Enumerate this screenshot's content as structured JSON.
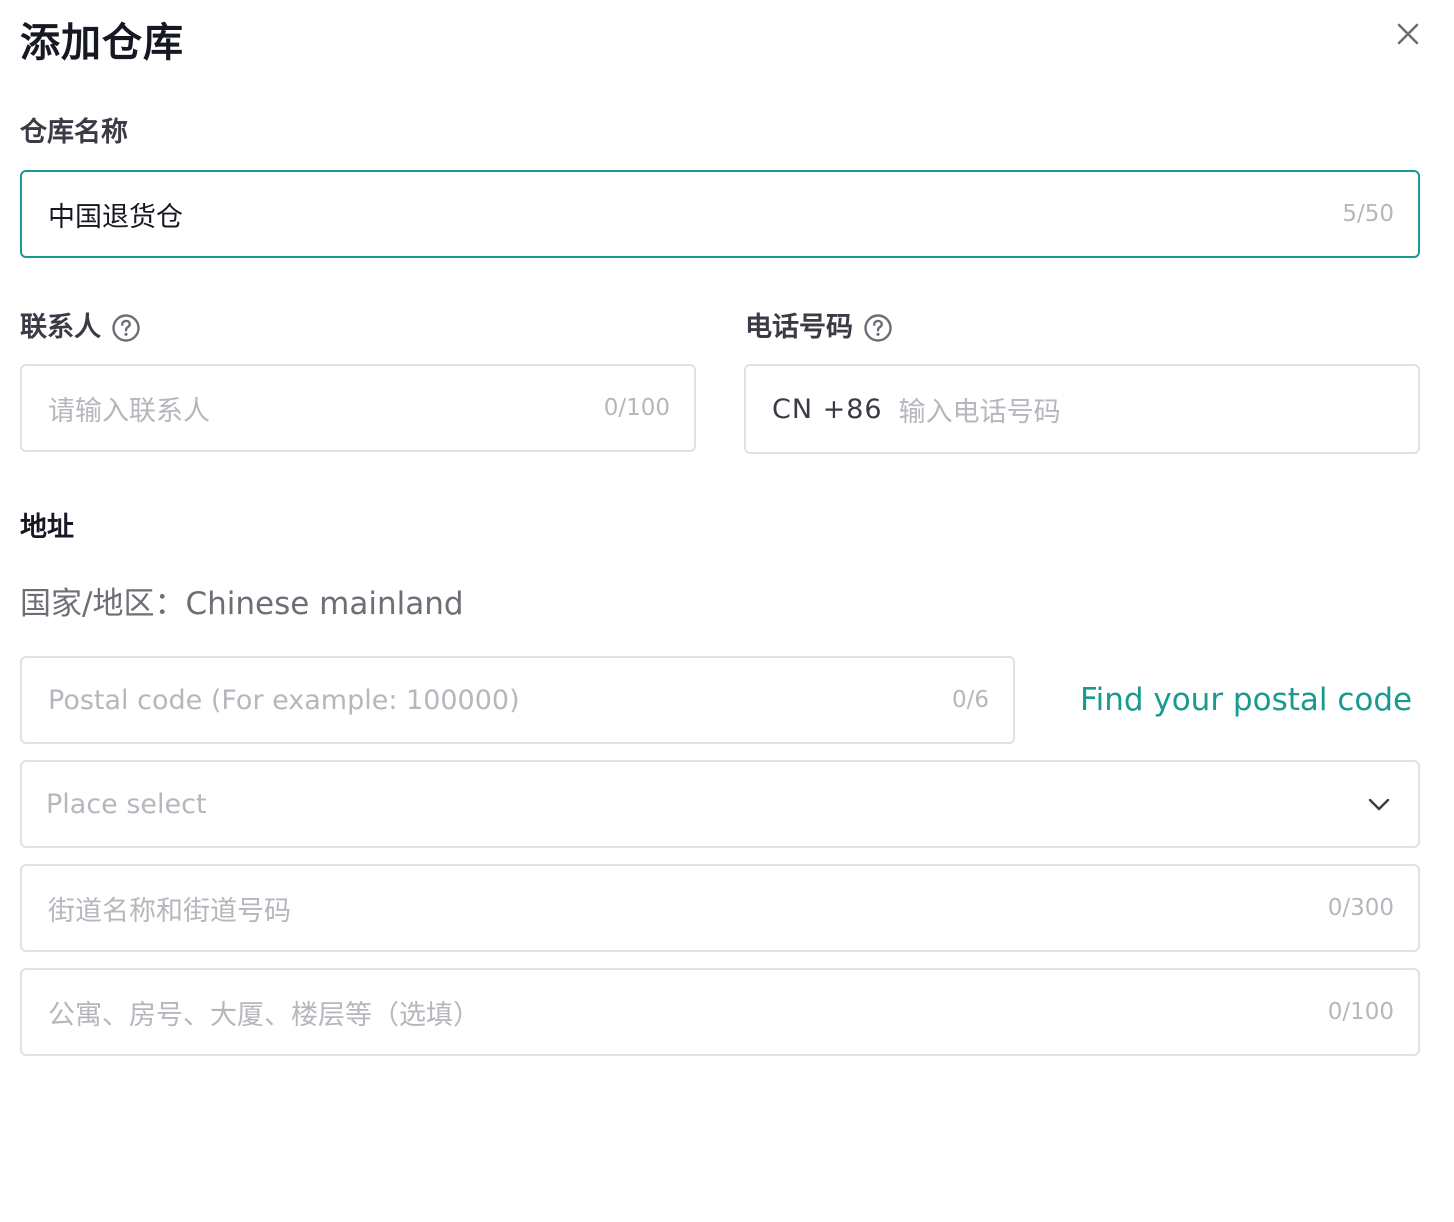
{
  "dialog": {
    "title": "添加仓库"
  },
  "warehouse_name": {
    "label": "仓库名称",
    "value": "中国退货仓",
    "counter": "5/50"
  },
  "contact": {
    "label": "联系人",
    "placeholder": "请输入联系人",
    "counter": "0/100"
  },
  "phone": {
    "label": "电话号码",
    "prefix": "CN +86",
    "placeholder": "输入电话号码"
  },
  "address": {
    "section_title": "地址",
    "country_label": "国家/地区：",
    "country_value": "Chinese mainland",
    "postal_placeholder": "Postal code (For example: 100000)",
    "postal_counter": "0/6",
    "find_postal_link": "Find your postal code",
    "region_select_placeholder": "Place select",
    "street_placeholder": "街道名称和街道号码",
    "street_counter": "0/300",
    "apartment_placeholder": "公寓、房号、大厦、楼层等（选填）",
    "apartment_counter": "0/100"
  },
  "colors": {
    "accent": "#1a9a8f",
    "border": "#dfe0e3",
    "placeholder": "#b6b7bd"
  },
  "icons": {
    "close": "close-icon",
    "help": "question-circle-icon",
    "dropdown": "chevron-down-icon"
  }
}
